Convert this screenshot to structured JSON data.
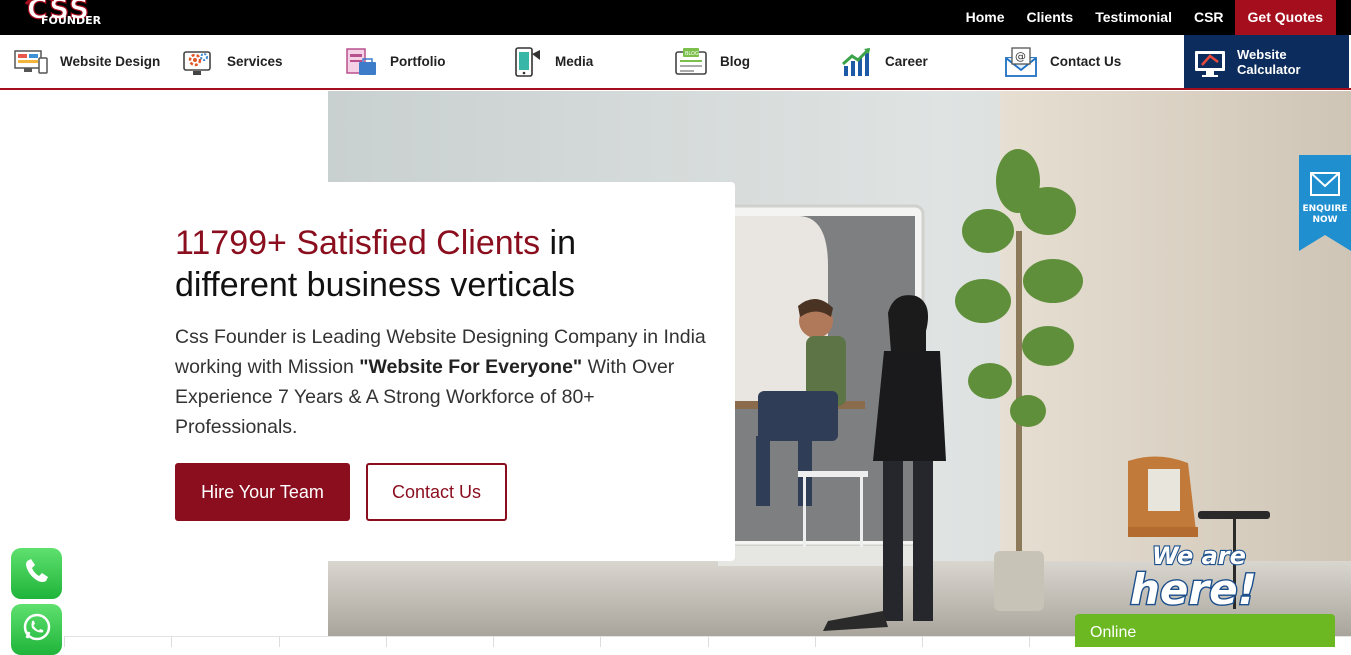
{
  "brand": {
    "logo_text": "CSS",
    "logo_sub": "FOUNDER",
    "accent_color": "#a50e1d",
    "nav_accent_color": "#0b2c5c"
  },
  "top_nav": {
    "links": [
      "Home",
      "Clients",
      "Testimonial",
      "CSR"
    ],
    "quote_label": "Get Quotes"
  },
  "main_nav": {
    "items": [
      {
        "label": "Website Design",
        "icon": "monitor-devices-icon"
      },
      {
        "label": "Services",
        "icon": "gear-monitor-icon"
      },
      {
        "label": "Portfolio",
        "icon": "portfolio-icon"
      },
      {
        "label": "Media",
        "icon": "media-phone-icon"
      },
      {
        "label": "Blog",
        "icon": "blog-icon"
      },
      {
        "label": "Career",
        "icon": "growth-chart-icon"
      },
      {
        "label": "Contact Us",
        "icon": "envelope-at-icon"
      }
    ],
    "calculator_line1": "Website",
    "calculator_line2": "Calculator"
  },
  "hero": {
    "title_accent": "11799+ Satisfied Clients",
    "title_rest_1": " in",
    "title_rest_2": "different business verticals",
    "desc_1": "Css Founder is Leading Website Designing Company in India working with Mission ",
    "desc_bold": "\"Website For Everyone\"",
    "desc_2": " With Over Experience 7 Years & A Strong Workforce of 80+ Professionals.",
    "primary_button": "Hire Your Team",
    "secondary_button": "Contact Us"
  },
  "enquire": {
    "line1": "ENQUIRE",
    "line2": "NOW"
  },
  "chat": {
    "we_are_here": "We are here!",
    "status": "Online",
    "status_color": "#6bb822"
  }
}
